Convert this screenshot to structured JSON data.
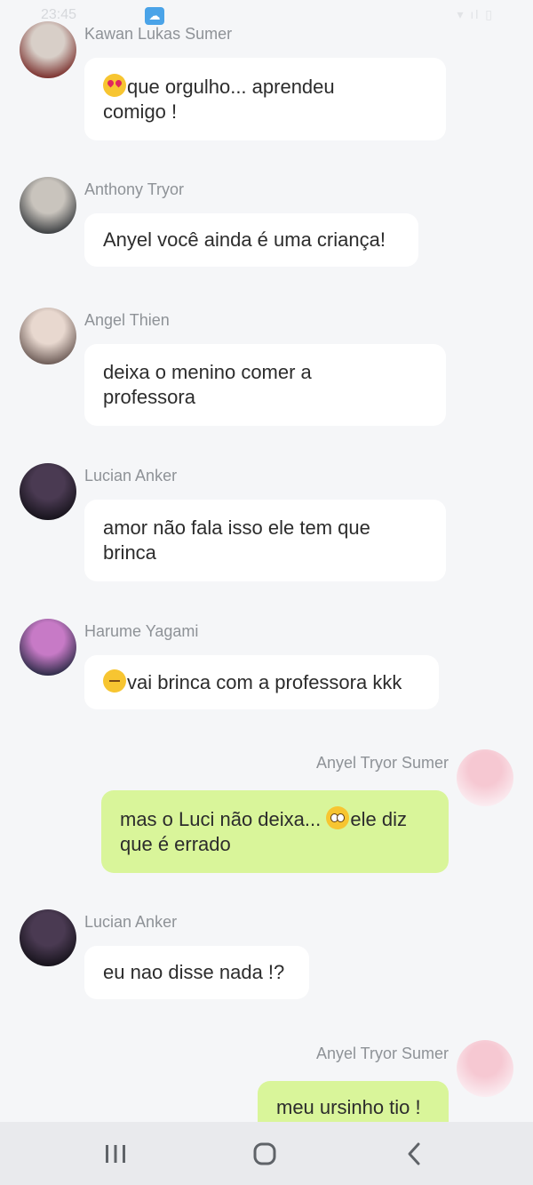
{
  "status_bar": {
    "time": "23:45"
  },
  "messages": [
    {
      "side": "left",
      "sender": "Kawan Lukas Sumer",
      "emoji": "heart-eyes",
      "lines": [
        "que orgulho... aprendeu",
        "comigo !"
      ],
      "avatar_colors": [
        "#d8cfc8",
        "#7a2f2c"
      ]
    },
    {
      "side": "left",
      "sender": "Anthony Tryor",
      "emoji": "",
      "lines": [
        "Anyel você ainda é uma criança!"
      ],
      "avatar_colors": [
        "#c9c4bd",
        "#3a3d40"
      ]
    },
    {
      "side": "left",
      "sender": "Angel Thien",
      "emoji": "",
      "lines": [
        "deixa o menino comer a",
        "professora"
      ],
      "avatar_colors": [
        "#e8d8cf",
        "#6b5a55"
      ]
    },
    {
      "side": "left",
      "sender": "Lucian Anker",
      "emoji": "",
      "lines": [
        "amor não fala isso ele tem que",
        "brinca"
      ],
      "avatar_colors": [
        "#4a3a52",
        "#15121a"
      ]
    },
    {
      "side": "left",
      "sender": "Harume Yagami",
      "emoji": "sleepy",
      "lines": [
        "vai brinca com a professora kkk"
      ],
      "avatar_colors": [
        "#c77ac6",
        "#2a2a45"
      ]
    },
    {
      "side": "right",
      "sender": "Anyel Tryor Sumer",
      "emoji": "",
      "lines": [
        "mas o Luci não deixa... [pleading]ele diz",
        "que é errado"
      ],
      "avatar_colors": [
        "#f6c8d2",
        "#fbeef2"
      ]
    },
    {
      "side": "left",
      "sender": "Lucian Anker",
      "emoji": "",
      "lines": [
        "eu nao disse nada !?"
      ],
      "avatar_colors": [
        "#4a3a52",
        "#15121a"
      ]
    },
    {
      "side": "right",
      "sender": "Anyel Tryor Sumer",
      "emoji": "",
      "lines": [
        "meu ursinho tio !"
      ],
      "avatar_colors": [
        "#f6c8d2",
        "#fbeef2"
      ]
    }
  ],
  "colors": {
    "background": "#f5f6f8",
    "incoming_bubble": "#ffffff",
    "outgoing_bubble": "#d9f59a",
    "sender_name": "#8e9297",
    "nav_bar": "#e9eaed",
    "nav_icon": "#5f6368"
  },
  "nav": {
    "recents_icon": "recents-icon",
    "home_icon": "home-icon",
    "back_icon": "back-icon"
  }
}
